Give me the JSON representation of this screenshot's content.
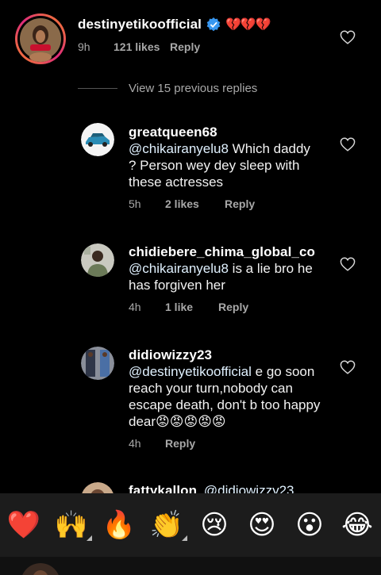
{
  "parent_comment": {
    "username": "destinyetikoofficial",
    "emojis": "💔💔💔",
    "time": "9h",
    "likes": "121 likes",
    "reply": "Reply"
  },
  "view_previous": "View 15 previous replies",
  "replies": [
    {
      "username": "greatqueen68",
      "mention": "@chikairanyelu8",
      "text": " Which daddy ?  Person  wey dey sleep with these actresses",
      "time": "5h",
      "likes": "2 likes",
      "reply": "Reply"
    },
    {
      "username": "chidiebere_chima_global_co",
      "mention": "@chikairanyelu8",
      "text": " is a lie bro he has forgiven her",
      "time": "4h",
      "likes": "1 like",
      "reply": "Reply"
    },
    {
      "username": "didiowizzy23",
      "mention": "@destinyetikoofficial",
      "text": " e go soon reach your turn,nobody can escape death, don't b too happy dear😡😡😡😡😡",
      "time": "4h",
      "likes": "",
      "reply": "Reply"
    },
    {
      "username": "fattykallon",
      "mention": "@didiowizzy23",
      "text": "",
      "time": "",
      "likes": "",
      "reply": ""
    }
  ],
  "emoji_bar": [
    "❤️",
    "🙌",
    "🔥",
    "👏",
    "😢",
    "😍",
    "😮",
    "😂"
  ],
  "icons": {
    "verified": "verified-badge-icon",
    "like": "heart-outline-icon"
  },
  "colors": {
    "background": "#000000",
    "verified": "#3897f0",
    "meta_text": "#a8a8a8",
    "story_ring_start": "#f58529",
    "story_ring_end": "#dd2a7b",
    "emoji_bar": "#1c1c1c"
  }
}
